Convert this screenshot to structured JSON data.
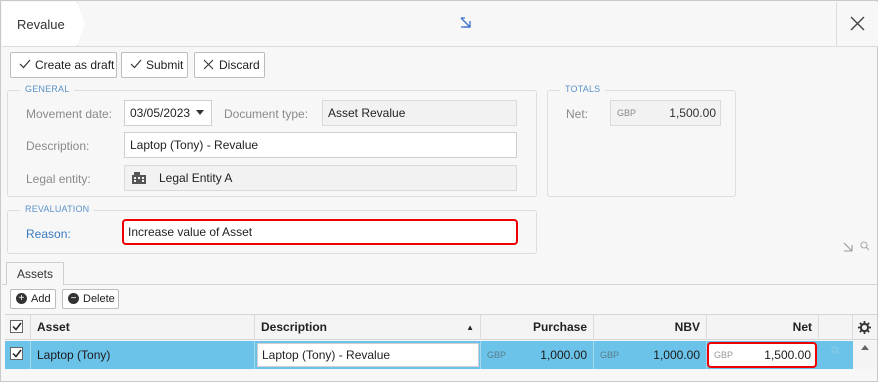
{
  "window": {
    "title": "Revalue"
  },
  "toolbar": {
    "create_draft_label": "Create as draft",
    "submit_label": "Submit",
    "discard_label": "Discard"
  },
  "general": {
    "legend": "GENERAL",
    "movement_date_label": "Movement date:",
    "movement_date_value": "03/05/2023",
    "document_type_label": "Document type:",
    "document_type_value": "Asset Revalue",
    "description_label": "Description:",
    "description_value": "Laptop (Tony) - Revalue",
    "legal_entity_label": "Legal entity:",
    "legal_entity_value": "Legal Entity A"
  },
  "totals": {
    "legend": "TOTALS",
    "net_label": "Net:",
    "net_currency": "GBP",
    "net_value": "1,500.00"
  },
  "revaluation": {
    "legend": "REVALUATION",
    "reason_label": "Reason:",
    "reason_value": "Increase value of Asset"
  },
  "tabs": [
    {
      "label": "Assets",
      "active": true
    }
  ],
  "grid_toolbar": {
    "add_label": "Add",
    "delete_label": "Delete"
  },
  "grid": {
    "columns": [
      "Asset",
      "Description",
      "Purchase",
      "NBV",
      "Net"
    ],
    "sort_column": "Description",
    "sort_direction": "ascending",
    "rows": [
      {
        "selected": true,
        "asset": "Laptop (Tony)",
        "description": "Laptop (Tony) - Revalue",
        "purchase_currency": "GBP",
        "purchase": "1,000.00",
        "nbv_currency": "GBP",
        "nbv": "1,000.00",
        "net_currency": "GBP",
        "net": "1,500.00"
      }
    ]
  },
  "colors": {
    "accent_blue": "#5b93c9",
    "row_highlight": "#6cc3ea",
    "highlight_red": "#e00000"
  }
}
